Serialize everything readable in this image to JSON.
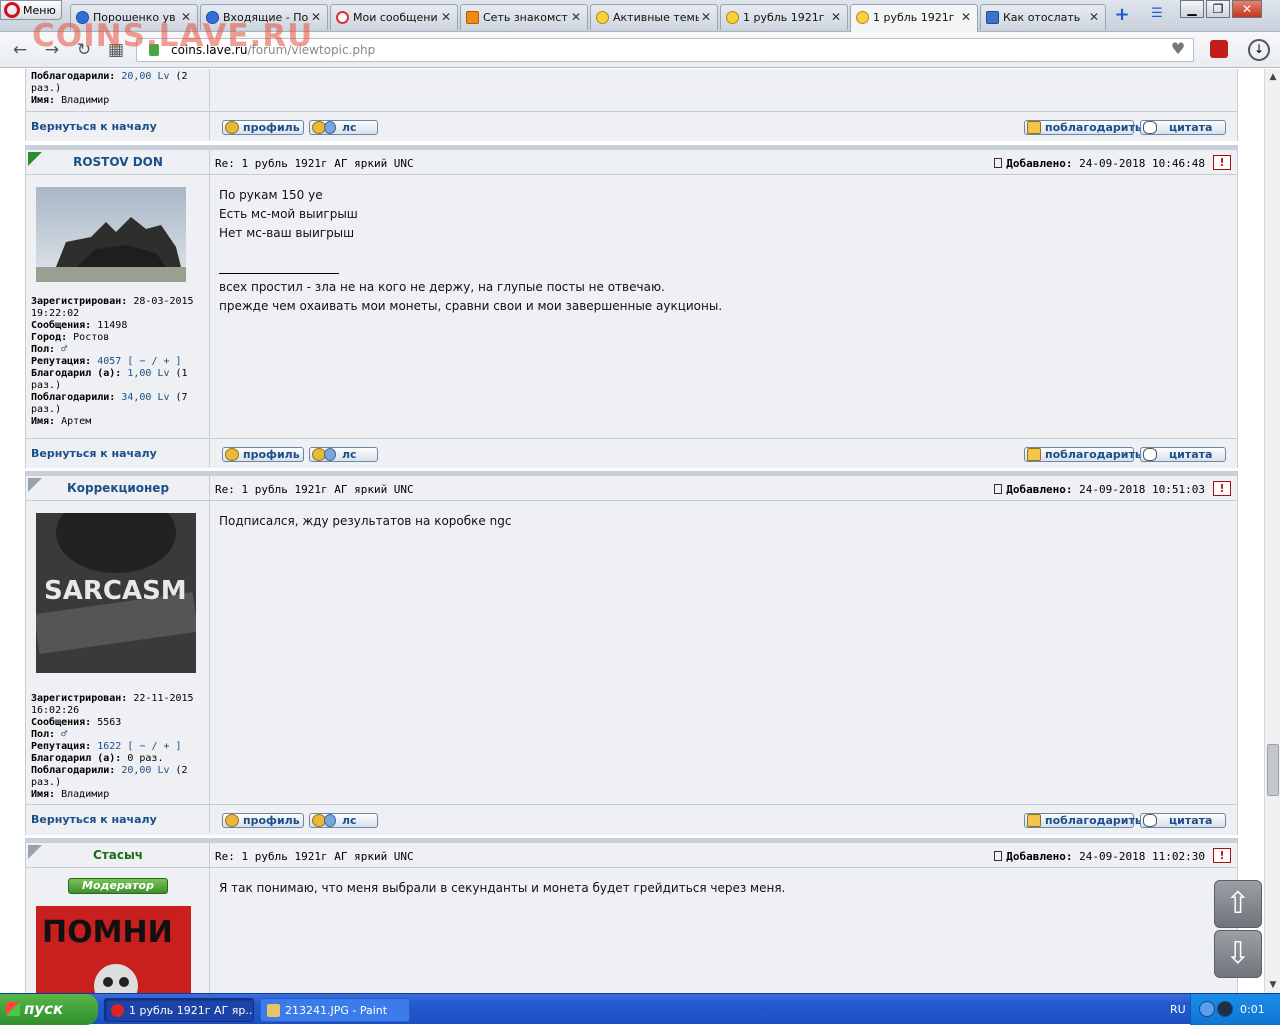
{
  "browser": {
    "menu_label": "Меню",
    "tabs": [
      {
        "label": "Порошенко ув"
      },
      {
        "label": "Входящие - По"
      },
      {
        "label": "Мои сообщени"
      },
      {
        "label": "Сеть знакомст"
      },
      {
        "label": "Активные темы"
      },
      {
        "label": "1 рубль 1921г"
      },
      {
        "label": "1 рубль 1921г"
      },
      {
        "label": "Как отослать"
      }
    ],
    "url_host": "coins.lave.ru",
    "url_path": "/forum/viewtopic.php",
    "new_tab": "+",
    "close_glyph": "✕"
  },
  "watermark": "COINS.LAVE.RU",
  "forum": {
    "back_to_top": "Вернуться к началу",
    "btn_profile": "профиль",
    "btn_pm": "лс",
    "btn_thank": "поблагодарить",
    "btn_quote": "цитата",
    "added_label": "Добавлено:",
    "report_glyph": "!",
    "prev_post_info": {
      "thanked_label": "Поблагодарили:",
      "thanked_value": "20,00 Lv",
      "thanked_count": "(2 раз.)",
      "name_label": "Имя:",
      "name": "Владимир"
    },
    "posts": [
      {
        "author": "ROSTOV DON",
        "subject": "Re: 1 рубль 1921г АГ яркий UNC",
        "date": "24-09-2018 10:46:48",
        "body": [
          "По рукам 150 уе",
          "Есть мс-мой выигрыш",
          "Нет мс-ваш выигрыш"
        ],
        "signature": [
          "всех простил - зла не на кого не держу, на глупые посты не отвечаю.",
          "прежде чем охаивать мои монеты, сравни свои и мои завершенные аукционы."
        ],
        "reg_label": "Зарегистрирован:",
        "reg": "28-03-2015 19:22:02",
        "msgs_label": "Сообщения:",
        "msgs": "11498",
        "city_label": "Город:",
        "city": "Ростов",
        "gender_label": "Пол:",
        "gender": "♂",
        "rep_label": "Репутация:",
        "rep": "4057",
        "rep_ctrl": "[ − / + ]",
        "thanked_by_label": "Благодарил (а):",
        "thanked_by": "1,00 Lv",
        "thanked_by_count": "(1 раз.)",
        "thanked_label": "Поблагодарили:",
        "thanked": "34,00 Lv",
        "thanked_count": "(7 раз.)",
        "name_label": "Имя:",
        "name": "Артем"
      },
      {
        "author": "Коррекционер",
        "subject": "Re: 1 рубль 1921г АГ яркий UNC",
        "date": "24-09-2018 10:51:03",
        "body": [
          "Подписался, жду результатов на коробке ngc"
        ],
        "avatar_text": "SARCASM",
        "reg_label": "Зарегистрирован:",
        "reg": "22-11-2015 16:02:26",
        "msgs_label": "Сообщения:",
        "msgs": "5563",
        "gender_label": "Пол:",
        "gender": "♂",
        "rep_label": "Репутация:",
        "rep": "1622",
        "rep_ctrl": "[ − / + ]",
        "thanked_by_label": "Благодарил (а):",
        "thanked_by": "0 раз.",
        "thanked_label": "Поблагодарили:",
        "thanked": "20,00 Lv",
        "thanked_count": "(2 раз.)",
        "name_label": "Имя:",
        "name": "Владимир"
      },
      {
        "author": "Стасыч",
        "subject": "Re: 1 рубль 1921г АГ яркий UNC",
        "date": "24-09-2018 11:02:30",
        "body": [
          "Я так понимаю, что меня выбрали в секунданты и монета будет грейдиться через меня."
        ],
        "badge": "Модератор",
        "avatar_text": "ПОМНИ"
      }
    ]
  },
  "scroll_arrows": {
    "up": "⇧",
    "down": "⇩"
  },
  "taskbar": {
    "start": "пуск",
    "tasks": [
      {
        "label": "1 рубль 1921г АГ яр..."
      },
      {
        "label": "213241.JPG - Paint"
      }
    ],
    "lang": "RU",
    "clock": "0:01"
  },
  "colors": {
    "link": "#1b4f8a",
    "moderator_green": "#1a6d1a",
    "taskbar": "#245ad0"
  }
}
